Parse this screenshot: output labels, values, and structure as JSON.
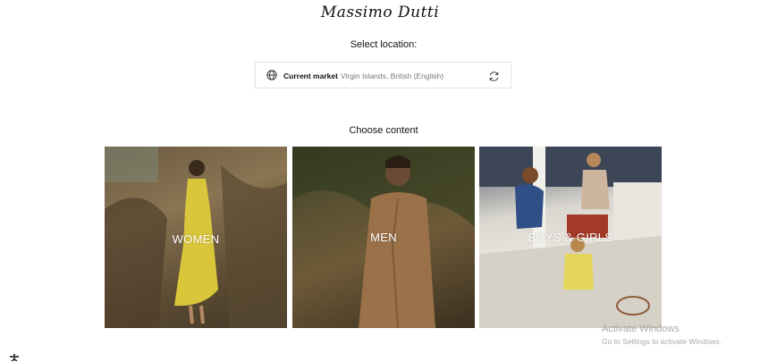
{
  "header": {
    "logo_text": "Massimo Dutti"
  },
  "location": {
    "title": "Select location:",
    "current_market_label": "Current market",
    "current_market_value": "Virgin Islands, British (English)",
    "globe_icon": "globe-icon",
    "refresh_icon": "refresh-icon"
  },
  "content": {
    "title": "Choose content",
    "tiles": [
      {
        "label": "WOMEN"
      },
      {
        "label": "MEN"
      },
      {
        "label": "BOYS & GIRLS"
      }
    ]
  },
  "os_watermark": {
    "title": "Activate Windows",
    "subtitle": "Go to Settings to activate Windows."
  }
}
